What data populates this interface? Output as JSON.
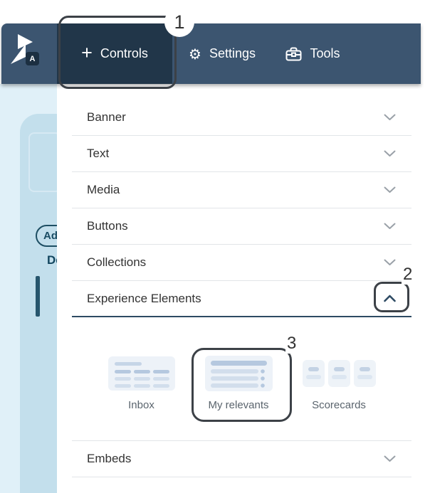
{
  "topbar": {
    "logo_badge": "A",
    "tabs": [
      {
        "label": "Controls",
        "icon": "plus-icon",
        "active": true
      },
      {
        "label": "Settings",
        "icon": "gear-icon",
        "active": false
      },
      {
        "label": "Tools",
        "icon": "toolbox-icon",
        "active": false
      }
    ],
    "gear_glyph": "⚙"
  },
  "panel": {
    "sections": [
      {
        "label": "Banner",
        "state": "collapsed"
      },
      {
        "label": "Text",
        "state": "collapsed"
      },
      {
        "label": "Media",
        "state": "collapsed"
      },
      {
        "label": "Buttons",
        "state": "collapsed"
      },
      {
        "label": "Collections",
        "state": "collapsed"
      },
      {
        "label": "Experience Elements",
        "state": "expanded"
      },
      {
        "label": "Embeds",
        "state": "collapsed"
      }
    ],
    "experience_elements_items": [
      {
        "label": "Inbox",
        "icon": "inbox-widget-icon"
      },
      {
        "label": "My relevants",
        "icon": "relevants-widget-icon"
      },
      {
        "label": "Scorecards",
        "icon": "scorecards-widget-icon"
      }
    ]
  },
  "background_page": {
    "add_button_label": "Ad",
    "truncated_heading": "De"
  },
  "annotations": [
    {
      "number": "1",
      "target": "controls-tab"
    },
    {
      "number": "2",
      "target": "experience-elements-collapse-chevron"
    },
    {
      "number": "3",
      "target": "my-relevants-item"
    }
  ],
  "colors": {
    "topbar": "#3c5570",
    "topbar_active_tab": "#213649",
    "accent_navy": "#2d4a63",
    "annotation_border": "#3c4147",
    "sidebar_light": "#e0f0f8",
    "sidebar_card": "#c3dfec",
    "teal_dark": "#1a4c63",
    "tile_bg": "#edf2f8",
    "tile_bar_dark": "#b5c8df",
    "tile_bar_light": "#d2deec",
    "divider": "#e2e5e8"
  }
}
